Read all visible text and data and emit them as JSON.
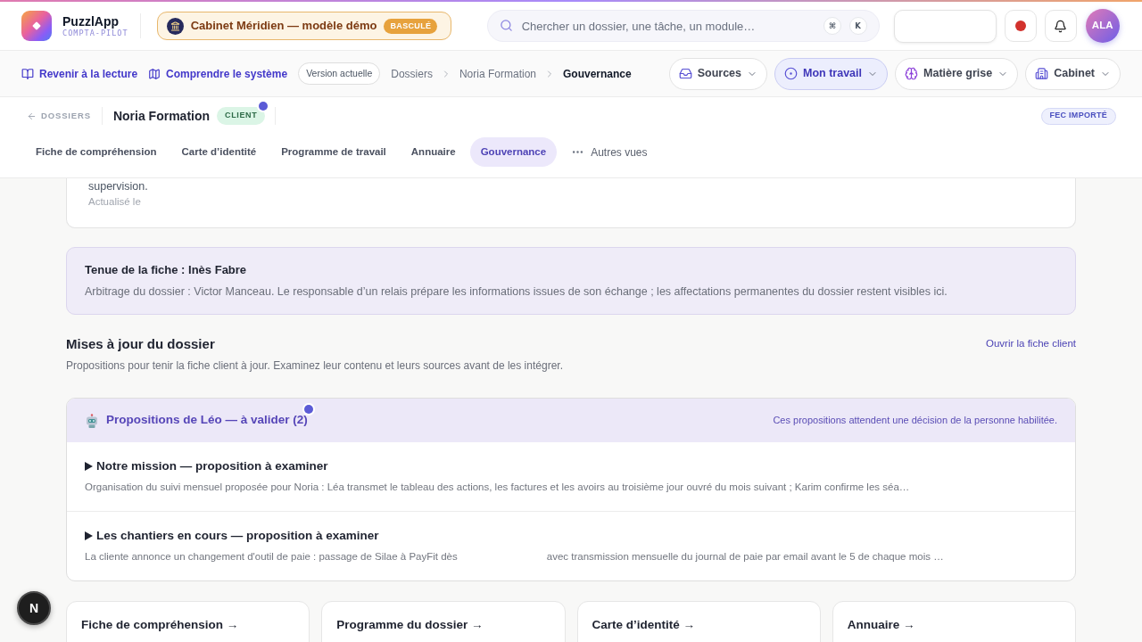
{
  "top_bar": {
    "app_name": "PuzzlApp",
    "app_subtitle": "COMPTA-PILOT",
    "workspace": {
      "name": "Cabinet Méridien — modèle démo",
      "badge": "BASCULÉ"
    },
    "search": {
      "placeholder": "Chercher un dossier, une tâche, un module…",
      "shortcut_keys": [
        "⌘",
        "K"
      ]
    },
    "recording": true,
    "avatar": "ALA"
  },
  "nav_bar": {
    "links": [
      "Revenir à la lecture",
      "Comprendre le système"
    ],
    "version": "Version actuelle",
    "breadcrumb": [
      {
        "label": "Dossiers",
        "current": false
      },
      {
        "label": "Noria Formation",
        "current": false
      },
      {
        "label": "Gouvernance",
        "current": true
      }
    ],
    "menus": [
      {
        "label": "Sources",
        "selected": false
      },
      {
        "label": "Mon travail",
        "selected": true
      },
      {
        "label": "Matière grise",
        "selected": false
      },
      {
        "label": "Cabinet",
        "selected": false
      }
    ]
  },
  "folder_header": {
    "back_link": "DOSSIERS",
    "name": "Noria Formation",
    "badge": {
      "label": "CLIENT",
      "dot": true
    },
    "status_badge": "FEC IMPORTÉ",
    "tabs": [
      {
        "label": "Fiche de compréhension",
        "selected": false
      },
      {
        "label": "Carte d’identité",
        "selected": false
      },
      {
        "label": "Programme de travail",
        "selected": false
      },
      {
        "label": "Annuaire",
        "selected": false
      },
      {
        "label": "Gouvernance",
        "selected": true
      }
    ],
    "more_views": "Autres vues"
  },
  "previous_card": {
    "text": "supervision.",
    "updated": "Actualisé le"
  },
  "ownership_card": {
    "title": "Tenue de la fiche : Inès Fabre",
    "text": "Arbitrage du dossier : Victor Manceau. Le responsable d’un relais prépare les informations issues de son échange ; les affectations permanentes du dossier restent visibles ici."
  },
  "updates_section": {
    "title": "Mises à jour du dossier",
    "link": "Ouvrir la fiche client",
    "subtitle": "Propositions pour tenir la fiche client à jour. Examinez leur contenu et leurs sources avant de les intégrer.",
    "proposals": {
      "title": "Propositions de Léo — à valider (2)",
      "dot": true,
      "note": "Ces propositions attendent une décision de la personne habilitée.",
      "items": [
        {
          "title": "Notre mission — proposition à examiner",
          "expanded": false,
          "summary": [
            "Organisation du suivi mensuel proposée pour Noria : Léa transmet le tableau des actions, les factures et les avoirs au troisième jour ouvré du mois suivant ; Karim confirme les séa…"
          ]
        },
        {
          "title": "Les chantiers en cours — proposition à examiner",
          "expanded": false,
          "summary": [
            "La cliente annonce un changement d'outil de paie : passage de Silae à PayFit dès",
            "avec transmission mensuelle du journal de paie par email avant le 5 de chaque mois …"
          ]
        }
      ]
    }
  },
  "shortcut_cards": [
    {
      "title": "Fiche de compréhension →"
    },
    {
      "title": "Programme du dossier →"
    },
    {
      "title": "Carte d’identité →"
    },
    {
      "title": "Annuaire →"
    }
  ],
  "dev_badge": "N"
}
